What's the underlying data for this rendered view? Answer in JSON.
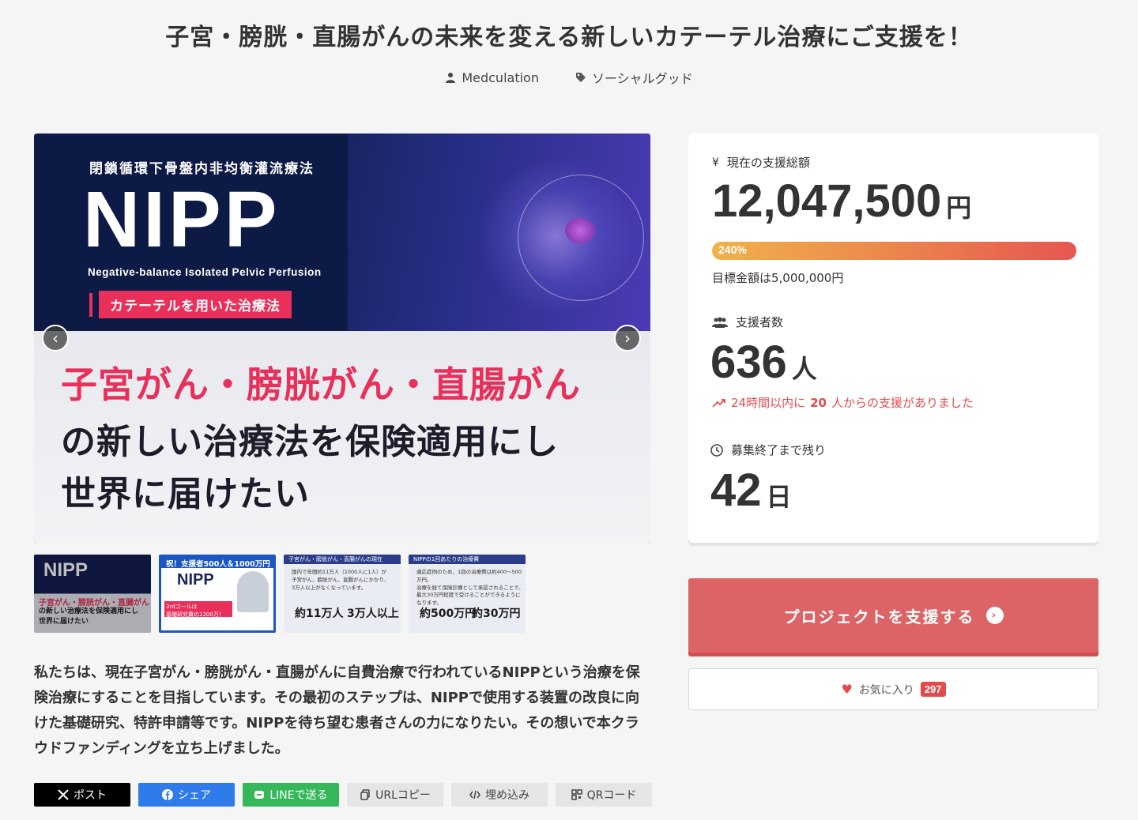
{
  "project": {
    "title": "子宮・膀胱・直腸がんの未来を変える新しいカテーテル治療にご支援を！",
    "owner": "Medculation",
    "category": "ソーシャルグッド"
  },
  "hero": {
    "kanji_title": "閉鎖循環下骨盤内非均衡灌流療法",
    "nipp": "NIPP",
    "nipp_full": "Negative-balance Isolated Pelvic Perfusion",
    "catheter_label": "カテーテルを用いた治療法",
    "line1": "子宮がん・膀胱がん・直腸がん",
    "line2": "の新しい治療法を保険適用にし",
    "line3": "世界に届けたい",
    "prev_arrow": "‹",
    "next_arrow": "›"
  },
  "thumbs": {
    "t1": {
      "logo": "NIPP",
      "red": "子宮がん・膀胱がん・直腸がん",
      "black1": "の新しい治療法を保険適用にし",
      "black2": "世界に届けたい"
    },
    "t2": {
      "header": "祝！支援者500人＆1000万円達成！",
      "logo": "NIPP",
      "red1": "3rdゴールは",
      "red2": "基礎研究費の1200万！"
    },
    "t3": {
      "header": "子宮がん・膀胱がん・直腸がんの現在",
      "text1": "国内で年間約11万人（1000人に1人）が",
      "text2": "子宮がん、膀胱がん、直腸がんにかかり、",
      "text3": "3万人以上がなくなっています。",
      "big1": "約11万人",
      "big2": "3万人以上"
    },
    "t4": {
      "header": "NIPPの1回あたりの治療費",
      "text1": "適応症例のため、1回の治療費は約400〜500万円。",
      "text2": "治療を経て保険診療として承認されることで、",
      "text3": "最大30万円程度で受けることができるようになります。",
      "big1": "約500万円",
      "big2": "約30万円"
    }
  },
  "description": "私たちは、現在子宮がん・膀胱がん・直腸がんに自費治療で行われているNIPPという治療を保険治療にすることを目指しています。その最初のステップは、NIPPで使用する装置の改良に向けた基礎研究、特許申請等です。NIPPを待ち望む患者さんの力になりたい。その想いで本クラウドファンディングを立ち上げました。",
  "share": {
    "x_post": "ポスト",
    "facebook": "シェア",
    "line": "LINEで送る",
    "url_copy": "URLコピー",
    "embed": "埋め込み",
    "qr": "QRコード"
  },
  "funding": {
    "yen_symbol": "¥",
    "total_label": "現在の支援総額",
    "total_amount": "12,047,500",
    "total_unit": "円",
    "progress_label": "240%",
    "progress_value": 2.4,
    "goal_text": "目標金額は5,000,000円",
    "backers_label": "支援者数",
    "backers_count": "636",
    "backers_unit": "人",
    "recent_prefix": "24時間以内に",
    "recent_count": "20",
    "recent_suffix": "人からの支援がありました",
    "remaining_label": "募集終了まで残り",
    "remaining_days": "42",
    "remaining_unit": "日"
  },
  "actions": {
    "support_button": "プロジェクトを支援する",
    "favorite_label": "お気に入り",
    "favorite_count": "297"
  },
  "colors": {
    "accent_red": "#dc6366",
    "pink": "#e8305a",
    "navy": "#0d1a46",
    "recent_red": "#e54a4a"
  }
}
